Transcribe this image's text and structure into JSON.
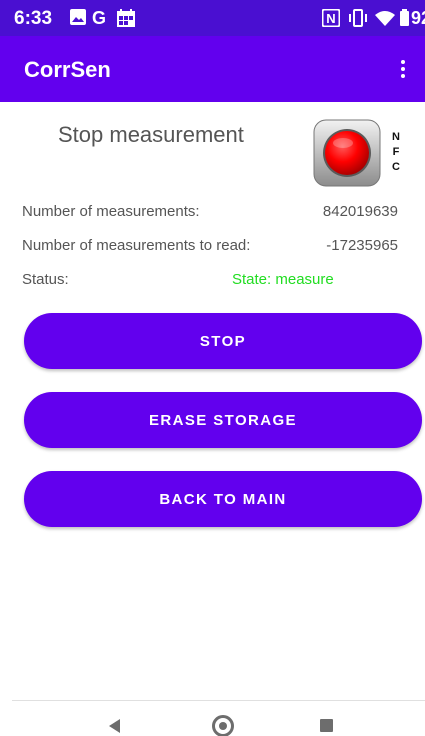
{
  "status_bar": {
    "time": "6:33",
    "left_icons": [
      "image-icon",
      "google-icon",
      "calendar-icon"
    ],
    "google_letter": "G",
    "nfc_letter": "N",
    "right_icons": [
      "nfc-icon",
      "vibrate-icon",
      "wifi-icon",
      "battery-icon"
    ],
    "battery": "92%"
  },
  "app_bar": {
    "title": "CorrSen",
    "menu_icon": "more-vert-icon"
  },
  "main": {
    "heading": "Stop measurement",
    "nfc_indicator": {
      "icon": "record-red-icon",
      "letters": [
        "N",
        "F",
        "C"
      ],
      "accent": "#ff0000"
    },
    "rows": [
      {
        "label": "Number of measurements:",
        "value": "842019639"
      },
      {
        "label": "Number of measurements to read:",
        "value": "-17235965"
      }
    ],
    "status": {
      "label": "Status:",
      "value": "State:  measure",
      "color": "#22dd22"
    },
    "buttons": {
      "stop": "STOP",
      "erase": "ERASE STORAGE",
      "back": "BACK TO MAIN"
    }
  },
  "nav_bar": {
    "icons": [
      "back-icon",
      "home-icon",
      "recents-icon"
    ]
  },
  "colors": {
    "status_bar": "#4a0fd1",
    "primary": "#6200ee",
    "text": "#555555"
  }
}
